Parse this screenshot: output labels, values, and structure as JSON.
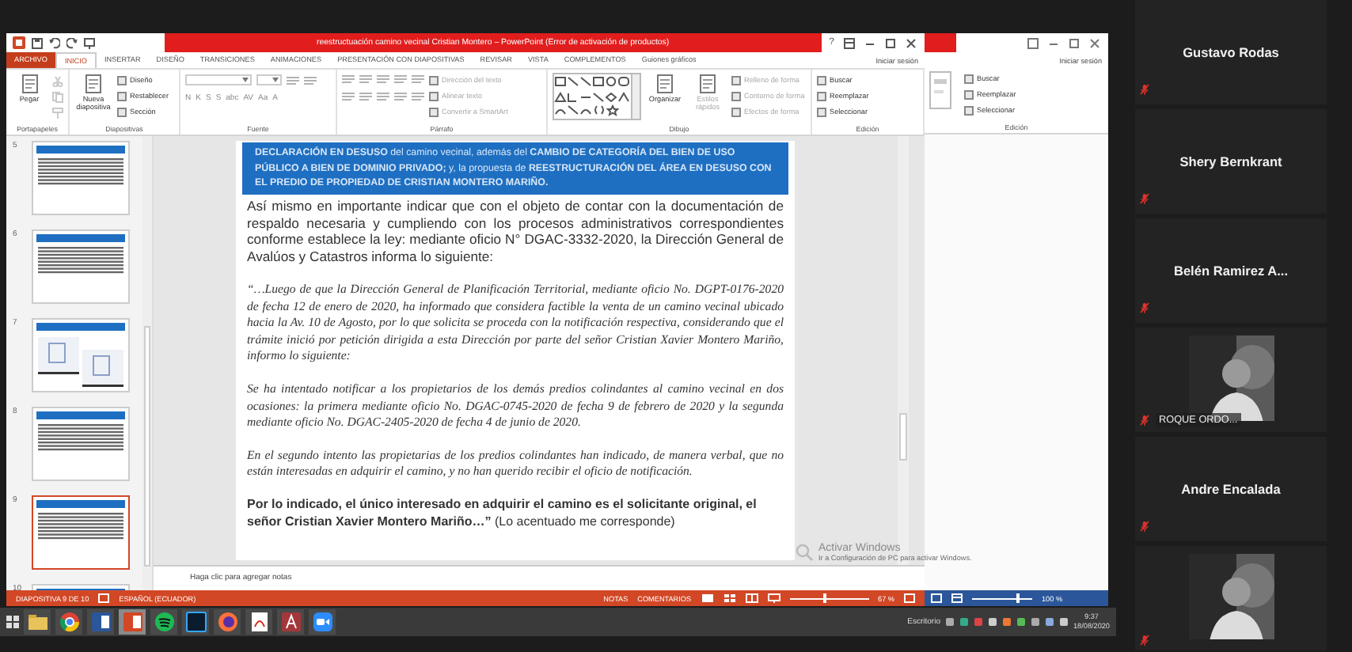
{
  "powerpoint": {
    "title": "reestructuación camino vecinal Cristian Montero – PowerPoint (Error de activación de productos)",
    "help": "?",
    "account": "Iniciar sesión",
    "tabs": [
      {
        "label": "ARCHIVO",
        "kind": "file",
        "selected": false
      },
      {
        "label": "INICIO",
        "kind": "tab",
        "selected": true
      },
      {
        "label": "INSERTAR",
        "kind": "tab",
        "selected": false
      },
      {
        "label": "DISEÑO",
        "kind": "tab",
        "selected": false
      },
      {
        "label": "TRANSICIONES",
        "kind": "tab",
        "selected": false
      },
      {
        "label": "ANIMACIONES",
        "kind": "tab",
        "selected": false
      },
      {
        "label": "PRESENTACIÓN CON DIAPOSITIVAS",
        "kind": "tab",
        "selected": false
      },
      {
        "label": "REVISAR",
        "kind": "tab",
        "selected": false
      },
      {
        "label": "VISTA",
        "kind": "tab",
        "selected": false
      },
      {
        "label": "COMPLEMENTOS",
        "kind": "tab",
        "selected": false
      },
      {
        "label": "Guiones gráficos",
        "kind": "tab",
        "selected": false
      }
    ],
    "ribbon": [
      {
        "label": "Portapapeles",
        "kind": "plain",
        "items": [
          {
            "kind": "large",
            "label": "Pegar",
            "disabled": false
          },
          {
            "kind": "icons",
            "disabled": true
          }
        ]
      },
      {
        "label": "Diapositivas",
        "kind": "plain",
        "items": [
          {
            "kind": "large",
            "label": "Nueva diapositiva",
            "disabled": false
          },
          {
            "kind": "small",
            "label": "Diseño",
            "disabled": false
          },
          {
            "kind": "small",
            "label": "Restablecer",
            "disabled": false
          },
          {
            "kind": "small",
            "label": "Sección",
            "disabled": false
          }
        ]
      },
      {
        "label": "Fuente",
        "kind": "font",
        "letters": [
          "N",
          "K",
          "S",
          "S",
          "abc",
          "AV",
          "Aa",
          "A"
        ]
      },
      {
        "label": "Párrafo",
        "kind": "paragraph",
        "items": [
          {
            "kind": "small",
            "label": "Dirección del texto",
            "disabled": true
          },
          {
            "kind": "small",
            "label": "Alinear texto",
            "disabled": true
          },
          {
            "kind": "small",
            "label": "Convertir a SmartArt",
            "disabled": true
          }
        ]
      },
      {
        "label": "Dibujo",
        "kind": "drawing",
        "items": [
          {
            "kind": "large",
            "label": "Organizar",
            "disabled": false
          },
          {
            "kind": "large",
            "label": "Estilos rápidos",
            "disabled": true
          },
          {
            "kind": "small",
            "label": "Relleno de forma",
            "disabled": true
          },
          {
            "kind": "small",
            "label": "Contorno de forma",
            "disabled": true
          },
          {
            "kind": "small",
            "label": "Efectos de forma",
            "disabled": true
          }
        ]
      },
      {
        "label": "Edición",
        "kind": "plain",
        "items": [
          {
            "kind": "small",
            "label": "Buscar",
            "disabled": false
          },
          {
            "kind": "small",
            "label": "Reemplazar",
            "disabled": false
          },
          {
            "kind": "small",
            "label": "Seleccionar",
            "disabled": false
          }
        ]
      }
    ],
    "thumbnails": [
      {
        "number": "5",
        "selected": false
      },
      {
        "number": "6",
        "selected": false
      },
      {
        "number": "7",
        "selected": false
      },
      {
        "number": "8",
        "selected": false
      },
      {
        "number": "9",
        "selected": true
      },
      {
        "number": "10",
        "selected": false
      }
    ],
    "slide": {
      "header": "**DECLARACIÓN EN DESUSO** del camino vecinal, además del **CAMBIO DE CATEGORÍA DEL BIEN DE USO PÚBLICO A BIEN DE DOMINIO PRIVADO;** y, la propuesta de **REESTRUCTURACIÓN DEL ÁREA EN DESUSO CON EL PREDIO DE PROPIEDAD DE CRISTIAN MONTERO MARIÑO.**",
      "paragraphs": [
        {
          "kind": "body",
          "text": "Así mismo en importante indicar que con el objeto de contar con la documentación de respaldo necesaria y cumpliendo con los procesos administrativos correspondientes conforme establece la ley: mediante oficio N° DGAC-3332-2020, la Dirección General de Avalúos y Catastros informa lo siguiente:"
        },
        {
          "kind": "quote",
          "text": "“…Luego de que la Dirección General de Planificación Territorial, mediante oficio No. DGPT-0176-2020 de fecha 12 de enero de 2020, ha informado que considera factible la venta de un camino vecinal ubicado hacia la Av. 10 de Agosto, por lo que solicita se proceda con la notificación respectiva, considerando que el trámite inició por petición dirigida a esta Dirección por parte del señor Cristian Xavier Montero Mariño, informo lo siguiente:"
        },
        {
          "kind": "quote",
          "text": "Se ha intentado notificar a los propietarios de los demás predios colindantes al camino vecinal en dos ocasiones: la primera mediante oficio No. DGAC-0745-2020 de fecha 9 de febrero de 2020 y la segunda mediante oficio No. DGAC-2405-2020 de fecha 4 de junio de 2020."
        },
        {
          "kind": "quote",
          "text": "En el segundo intento las propietarias de los predios colindantes han indicado, de manera verbal, que no están interesadas en adquirir el camino, y no han querido recibir el oficio de notificación."
        },
        {
          "kind": "closing",
          "text": "**Por lo indicado, el único interesado en adquirir el camino es el solicitante original, el señor Cristian Xavier Montero Mariño…”** (Lo acentuado me corresponde)"
        }
      ]
    },
    "notes_placeholder": "Haga clic para agregar notas",
    "status_bar": {
      "slide": "DIAPOSITIVA 9 DE 10",
      "language": "ESPAÑOL (ECUADOR)",
      "notes": "NOTAS",
      "comments": "COMENTARIOS",
      "zoom": "67 %",
      "zoom_slider": {
        "level": 0.45
      }
    }
  },
  "back_window": {
    "account": "Iniciar sesión",
    "items": [
      {
        "label": "Buscar"
      },
      {
        "label": "Reemplazar"
      },
      {
        "label": "Seleccionar"
      }
    ],
    "group_label": "Edición",
    "status_bar": {
      "zoom": "100 %",
      "zoom_slider": {
        "level": 0.75
      }
    }
  },
  "activation": {
    "title": "Activar Windows",
    "hint": "Ir a Configuración de PC para activar Windows."
  },
  "taskbar": {
    "apps": [
      {
        "selected": false
      },
      {
        "selected": false
      },
      {
        "selected": false
      },
      {
        "selected": true
      },
      {
        "selected": false
      },
      {
        "selected": false
      },
      {
        "selected": false
      },
      {
        "selected": false
      },
      {
        "selected": false
      },
      {
        "selected": false
      }
    ],
    "desktop": "Escritorio",
    "time": "9:37",
    "date": "18/08/2020"
  },
  "participants": [
    {
      "kind": "name",
      "name": "Gustavo Rodas",
      "muted": true
    },
    {
      "kind": "name",
      "name": "Shery Bernkrant",
      "muted": true
    },
    {
      "kind": "name",
      "name": "Belén Ramirez A...",
      "muted": true
    },
    {
      "kind": "video",
      "name": "ROQUE ORDO...",
      "muted": true
    },
    {
      "kind": "name",
      "name": "Andre Encalada",
      "muted": true
    },
    {
      "kind": "video",
      "muted": true
    }
  ]
}
